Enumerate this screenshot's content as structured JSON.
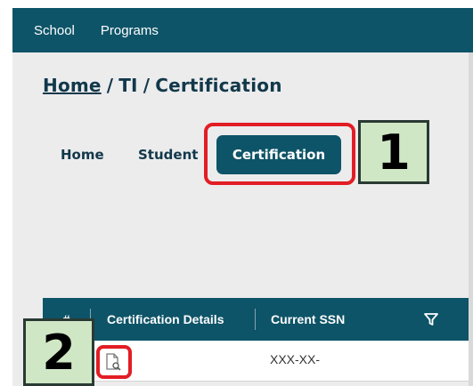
{
  "topnav": {
    "items": [
      "School",
      "Programs"
    ]
  },
  "breadcrumb": {
    "home": "Home",
    "sep1": "/",
    "section": "TI",
    "sep2": "/",
    "current": "Certification"
  },
  "tabs": {
    "home": "Home",
    "student": "Student",
    "certification": "Certification"
  },
  "callouts": {
    "one": "1",
    "two": "2"
  },
  "grid": {
    "columns": {
      "number": "#",
      "details": "Certification Details",
      "ssn": "Current SSN"
    },
    "rows": [
      {
        "ssn": "XXX-XX-"
      }
    ]
  },
  "colors": {
    "brand": "#0e5468",
    "highlight": "#e21d24",
    "callout_bg": "#cfe7c5",
    "page_bg": "#ececed"
  },
  "icons": [
    "filter-icon",
    "document-search-icon"
  ]
}
